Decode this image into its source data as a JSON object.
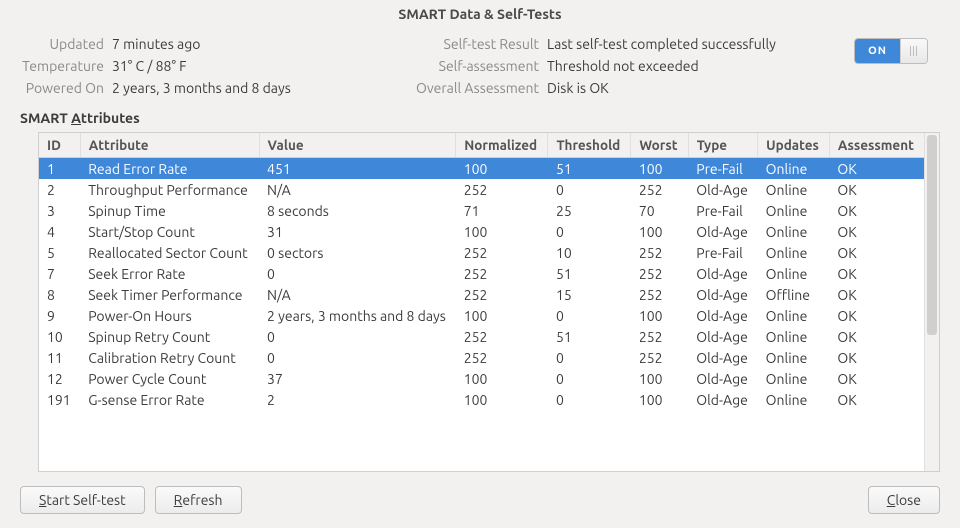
{
  "title": "SMART Data & Self-Tests",
  "info": {
    "updated_label": "Updated",
    "updated": "7 minutes ago",
    "temperature_label": "Temperature",
    "temperature": "31° C / 88° F",
    "powered_on_label": "Powered On",
    "powered_on": "2 years, 3 months and 8 days",
    "selftest_result_label": "Self-test Result",
    "selftest_result": "Last self-test completed successfully",
    "self_assessment_label": "Self-assessment",
    "self_assessment": "Threshold not exceeded",
    "overall_label": "Overall Assessment",
    "overall": "Disk is OK"
  },
  "toggle": {
    "state": "ON"
  },
  "section_title_prefix": "SMART ",
  "section_title_mn": "A",
  "section_title_suffix": "ttributes",
  "columns": {
    "id": "ID",
    "attribute": "Attribute",
    "value": "Value",
    "normalized": "Normalized",
    "threshold": "Threshold",
    "worst": "Worst",
    "type": "Type",
    "updates": "Updates",
    "assessment": "Assessment"
  },
  "rows": [
    {
      "id": "1",
      "attribute": "Read Error Rate",
      "value": "451",
      "normalized": "100",
      "threshold": "51",
      "worst": "100",
      "type": "Pre-Fail",
      "updates": "Online",
      "assessment": "OK",
      "selected": true
    },
    {
      "id": "2",
      "attribute": "Throughput Performance",
      "value": "N/A",
      "normalized": "252",
      "threshold": "0",
      "worst": "252",
      "type": "Old-Age",
      "updates": "Online",
      "assessment": "OK"
    },
    {
      "id": "3",
      "attribute": "Spinup Time",
      "value": "8 seconds",
      "normalized": "71",
      "threshold": "25",
      "worst": "70",
      "type": "Pre-Fail",
      "updates": "Online",
      "assessment": "OK"
    },
    {
      "id": "4",
      "attribute": "Start/Stop Count",
      "value": "31",
      "normalized": "100",
      "threshold": "0",
      "worst": "100",
      "type": "Old-Age",
      "updates": "Online",
      "assessment": "OK"
    },
    {
      "id": "5",
      "attribute": "Reallocated Sector Count",
      "value": "0 sectors",
      "normalized": "252",
      "threshold": "10",
      "worst": "252",
      "type": "Pre-Fail",
      "updates": "Online",
      "assessment": "OK"
    },
    {
      "id": "7",
      "attribute": "Seek Error Rate",
      "value": "0",
      "normalized": "252",
      "threshold": "51",
      "worst": "252",
      "type": "Old-Age",
      "updates": "Online",
      "assessment": "OK"
    },
    {
      "id": "8",
      "attribute": "Seek Timer Performance",
      "value": "N/A",
      "normalized": "252",
      "threshold": "15",
      "worst": "252",
      "type": "Old-Age",
      "updates": "Offline",
      "assessment": "OK"
    },
    {
      "id": "9",
      "attribute": "Power-On Hours",
      "value": "2 years, 3 months and 8 days",
      "normalized": "100",
      "threshold": "0",
      "worst": "100",
      "type": "Old-Age",
      "updates": "Online",
      "assessment": "OK"
    },
    {
      "id": "10",
      "attribute": "Spinup Retry Count",
      "value": "0",
      "normalized": "252",
      "threshold": "51",
      "worst": "252",
      "type": "Old-Age",
      "updates": "Online",
      "assessment": "OK"
    },
    {
      "id": "11",
      "attribute": "Calibration Retry Count",
      "value": "0",
      "normalized": "252",
      "threshold": "0",
      "worst": "252",
      "type": "Old-Age",
      "updates": "Online",
      "assessment": "OK"
    },
    {
      "id": "12",
      "attribute": "Power Cycle Count",
      "value": "37",
      "normalized": "100",
      "threshold": "0",
      "worst": "100",
      "type": "Old-Age",
      "updates": "Online",
      "assessment": "OK"
    },
    {
      "id": "191",
      "attribute": "G-sense Error Rate",
      "value": "2",
      "normalized": "100",
      "threshold": "0",
      "worst": "100",
      "type": "Old-Age",
      "updates": "Online",
      "assessment": "OK"
    }
  ],
  "buttons": {
    "start_prefix": "",
    "start_mn": "S",
    "start_suffix": "tart Self-test",
    "refresh_prefix": "",
    "refresh_mn": "R",
    "refresh_suffix": "efresh",
    "close_prefix": "",
    "close_mn": "C",
    "close_suffix": "lose"
  }
}
